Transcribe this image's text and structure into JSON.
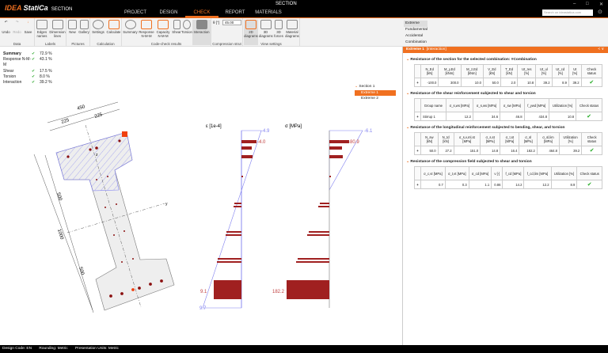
{
  "app": {
    "logo": "IDEA StatiCa",
    "product": "SECTION",
    "window_title": "SECTION",
    "search_placeholder": "Search on ideastatica.com"
  },
  "tabs": [
    "PROJECT",
    "DESIGN",
    "CHECK",
    "REPORT",
    "MATERIALS"
  ],
  "active_tab": "CHECK",
  "ribbon": {
    "groups": [
      {
        "label": "Data",
        "buttons": [
          "Undo",
          "Redo",
          "Save"
        ]
      },
      {
        "label": "Labels",
        "buttons": [
          "Edges names",
          "Dimension lines"
        ]
      },
      {
        "label": "Pictures",
        "buttons": [
          "New",
          "Gallery"
        ]
      },
      {
        "label": "Calculation",
        "buttons": [
          "Settings",
          "Calculate"
        ]
      },
      {
        "label": "Code-check results",
        "buttons": [
          "Summary",
          "Response N-M-M",
          "Capacity N-M-M",
          "Shear",
          "Torsion",
          "Interaction"
        ]
      },
      {
        "label": "Compression strut",
        "theta_label": "θ [°]",
        "theta_value": "45.00"
      },
      {
        "label": "View settings",
        "buttons": [
          "2D diagrams",
          "3D diagrams",
          "3D forces",
          "Material diagrams"
        ]
      },
      {
        "label": "Combination",
        "options": [
          "Extreme",
          "Fundamental",
          "Accidental"
        ],
        "selected": "Extreme"
      }
    ]
  },
  "summary": [
    {
      "name": "Summary",
      "value": "72.9 %"
    },
    {
      "name": "Response N-M-M",
      "value": "43.1 %"
    },
    {
      "name": "Shear",
      "value": "17.5 %"
    },
    {
      "name": "Torsion",
      "value": "8.0 %"
    },
    {
      "name": "Interaction",
      "value": "39.2 %"
    }
  ],
  "tree": {
    "section": "Section 1",
    "items": [
      "Extreme 1",
      "Extreme 2"
    ],
    "selected": "Extreme 1"
  },
  "drawing": {
    "dims": [
      "450",
      "225",
      "225",
      "500",
      "1000",
      "500"
    ],
    "axes": [
      "y",
      "z"
    ],
    "strain": {
      "title": "ε [1e-4]",
      "labels": [
        "-4.9",
        "-4.0",
        "9.1",
        "9.7"
      ]
    },
    "stress": {
      "title": "σ [MPa]",
      "labels": [
        "-6.1",
        "-80.9",
        "182.2"
      ]
    }
  },
  "panel": {
    "title": "Extreme 1",
    "subtitle": "[Interaction]",
    "controls": "< ∨",
    "sections": [
      {
        "title": "Resistance of the section for the selected combination: #Combination",
        "headers": [
          "N_Ed [kN]",
          "M_y,Ed [kNm]",
          "M_z,Ed [kNm]",
          "V_Ed [kN]",
          "T_Ed [kN]",
          "Ut_res [%]",
          "Ut_ul [%]",
          "Ut_cd [%]",
          "Ut [%]",
          "Check status"
        ],
        "row": [
          "-100.0",
          "300.0",
          "10.0",
          "50.0",
          "2.0",
          "10.8",
          "39.2",
          "8.9",
          "39.2"
        ]
      },
      {
        "title": "Resistance of the shear reinforcement subjected to shear and torsion",
        "headers": [
          "Group name",
          "σ_s,ws [MPa]",
          "σ_s,ws [MPa]",
          "σ_sw [MPa]",
          "f_ywd [MPa]",
          "Utilization [%]",
          "Check status"
        ],
        "row": [
          "Stirrup 1",
          "12.2",
          "34.6",
          "46.8",
          "434.8",
          "10.8"
        ]
      },
      {
        "title": "Resistance of the longitudinal reinforcement subjected to bending, shear, and torsion",
        "headers": [
          "N_sw [kN]",
          "N_td [kN]",
          "σ_s,v,ml,st [MPa]",
          "σ_s,st [MPa]",
          "σ_t,st [MPa]",
          "σ_sl [MPa]",
          "σ_sl,lim [MPa]",
          "Utilization [%]",
          "Check status"
        ],
        "row": [
          "50.0",
          "27.2",
          "151.0",
          "14.8",
          "16.4",
          "182.2",
          "464.8",
          "39.2"
        ]
      },
      {
        "title": "Resistance of the compression field subjected to shear and torsion",
        "headers": [
          "σ_c,vt [MPa]",
          "σ_t,vt [MPa]",
          "σ_cd [MPa]",
          "ν [-]",
          "f_cd [MPa]",
          "f_cd,lim [MPa]",
          "Utilization [%]",
          "Check status"
        ],
        "row": [
          "0.7",
          "0.3",
          "1.1",
          "0.86",
          "14.2",
          "12.2",
          "8.9"
        ]
      }
    ]
  },
  "status": {
    "design_code": "Design Code: EN",
    "rounding": "Rounding: Metric",
    "units": "Presentation Units: Metric"
  },
  "colors": {
    "accent": "#f07020",
    "rebar": "#a02020",
    "diagram": "#8080f0",
    "ok": "#2a2"
  }
}
